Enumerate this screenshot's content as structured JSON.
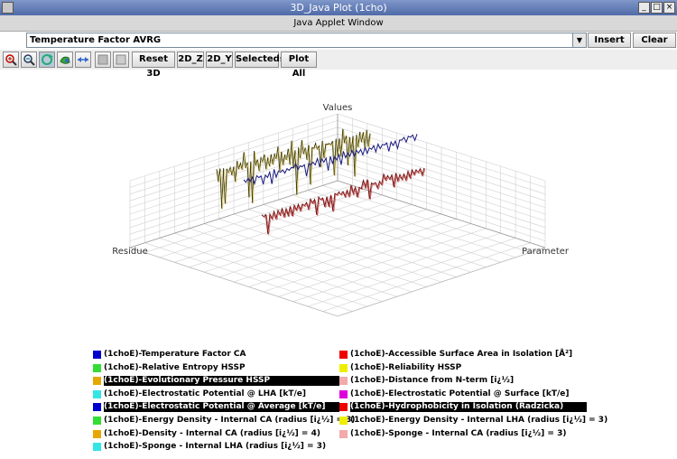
{
  "window": {
    "title": "3D_Java Plot (1cho)",
    "applet_label": "Java Applet Window"
  },
  "combo": {
    "selected": "Temperature Factor AVRG"
  },
  "buttons": {
    "insert": "Insert",
    "clear": "Clear",
    "reset3d": "Reset 3D",
    "z2d": "2D_Z",
    "y2d": "2D_Y",
    "selecteds": "Selecteds",
    "plotall": "Plot All"
  },
  "plot": {
    "axis_values": "Values",
    "axis_residue": "Residue",
    "axis_parameter": "Parameter"
  },
  "legend": {
    "left": [
      {
        "label": "(1choE)-Temperature Factor CA",
        "color": "#0000cc",
        "highlighted": false
      },
      {
        "label": "(1choE)-Relative Entropy HSSP",
        "color": "#33dd33",
        "highlighted": false
      },
      {
        "label": "(1choE)-Evolutionary Pressure HSSP",
        "color": "#e6a800",
        "highlighted": true
      },
      {
        "label": "(1choE)-Electrostatic Potential @ LHA [kT/e]",
        "color": "#33e6e6",
        "highlighted": false
      },
      {
        "label": "(1choE)-Electrostatic Potential @ Average [kT/e]",
        "color": "#0000cc",
        "highlighted": true
      },
      {
        "label": "(1choE)-Energy Density - Internal CA (radius [i¿½] = 3)",
        "color": "#33dd33",
        "highlighted": false
      },
      {
        "label": "(1choE)-Density - Internal CA (radius [i¿½] = 4)",
        "color": "#e6a800",
        "highlighted": false
      },
      {
        "label": "(1choE)-Sponge - Internal LHA (radius [i¿½] = 3)",
        "color": "#33e6e6",
        "highlighted": false
      }
    ],
    "right": [
      {
        "label": "(1choE)-Accessible Surface Area in Isolation [Å²]",
        "color": "#ee0000",
        "highlighted": false
      },
      {
        "label": "(1choE)-Reliability HSSP",
        "color": "#eeee00",
        "highlighted": false
      },
      {
        "label": "(1choE)-Distance from N-term [i¿½]",
        "color": "#f2aaaa",
        "highlighted": false
      },
      {
        "label": "(1choE)-Electrostatic Potential @ Surface [kT/e]",
        "color": "#dd00dd",
        "highlighted": false
      },
      {
        "label": "(1choE)-Hydrophobicity in Isolation (Radzicka)",
        "color": "#ee0000",
        "highlighted": true
      },
      {
        "label": "(1choE)-Energy Density - Internal LHA (radius [i¿½] = 3)",
        "color": "#eeee00",
        "highlighted": false
      },
      {
        "label": "(1choE)-Sponge - Internal CA (radius [i¿½] = 3)",
        "color": "#f2aaaa",
        "highlighted": false
      }
    ]
  },
  "icons": [
    "zoom-in-icon",
    "zoom-out-icon",
    "rotate-icon",
    "pan-icon",
    "fit-icon",
    "blank-icon",
    "blank-icon"
  ]
}
